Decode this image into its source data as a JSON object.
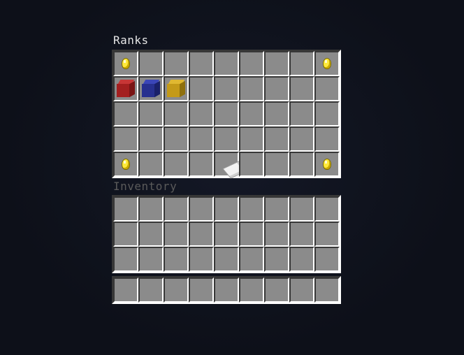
{
  "window": {
    "title": "Ranks",
    "inventory_label": "Inventory"
  },
  "ranks_grid": {
    "columns": 9,
    "rows": 5,
    "items": [
      {
        "slot": 0,
        "item": "glowstone-bulb-icon"
      },
      {
        "slot": 8,
        "item": "glowstone-bulb-icon"
      },
      {
        "slot": 9,
        "item": "red-wool-icon"
      },
      {
        "slot": 10,
        "item": "blue-wool-icon"
      },
      {
        "slot": 11,
        "item": "yellow-wool-icon"
      },
      {
        "slot": 36,
        "item": "glowstone-bulb-icon"
      },
      {
        "slot": 40,
        "item": "paper-icon"
      },
      {
        "slot": 44,
        "item": "glowstone-bulb-icon"
      }
    ]
  },
  "inventory_grid": {
    "columns": 9,
    "rows": 3
  },
  "hotbar_grid": {
    "columns": 9,
    "rows": 1
  },
  "colors": {
    "background": "#0d1019",
    "slot": "#8b8b8b",
    "title": "#e6e6e6",
    "inventory_label": "#5a5a5a"
  }
}
